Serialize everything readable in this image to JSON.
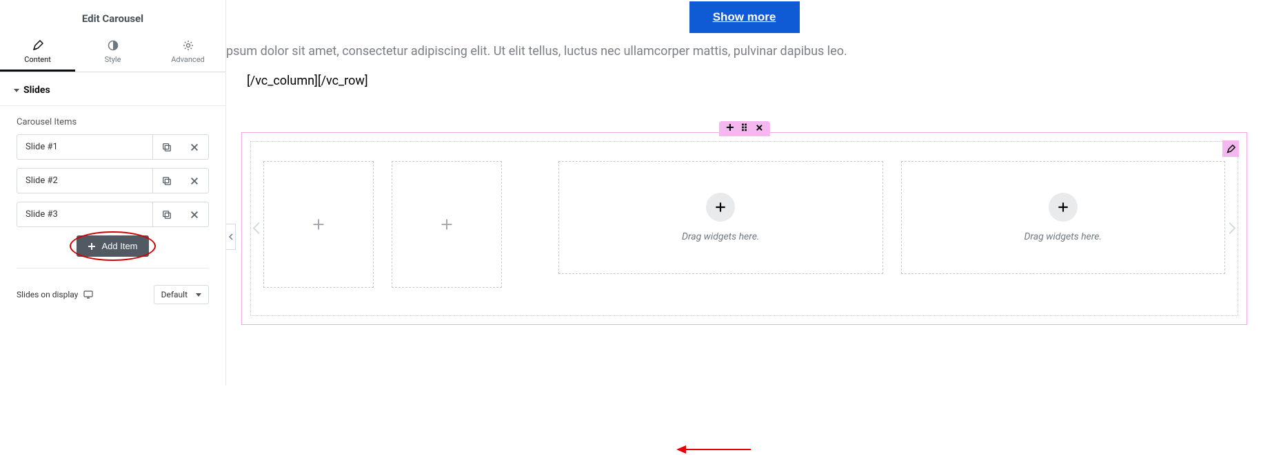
{
  "sidebar": {
    "title": "Edit Carousel",
    "tabs": {
      "content": "Content",
      "style": "Style",
      "advanced": "Advanced"
    },
    "section_header": "Slides",
    "items_label": "Carousel Items",
    "items": [
      {
        "label": "Slide #1"
      },
      {
        "label": "Slide #2"
      },
      {
        "label": "Slide #3"
      }
    ],
    "add_item": "Add Item",
    "slides_on_display_label": "Slides on display",
    "slides_on_display_value": "Default"
  },
  "canvas": {
    "show_more": "Show more",
    "lorem": "psum dolor sit amet, consectetur adipiscing elit. Ut elit tellus, luctus nec ullamcorper mattis, pulvinar dapibus leo.",
    "shortcode": "[/vc_column][/vc_row]",
    "drop_text": "Drag widgets here."
  }
}
